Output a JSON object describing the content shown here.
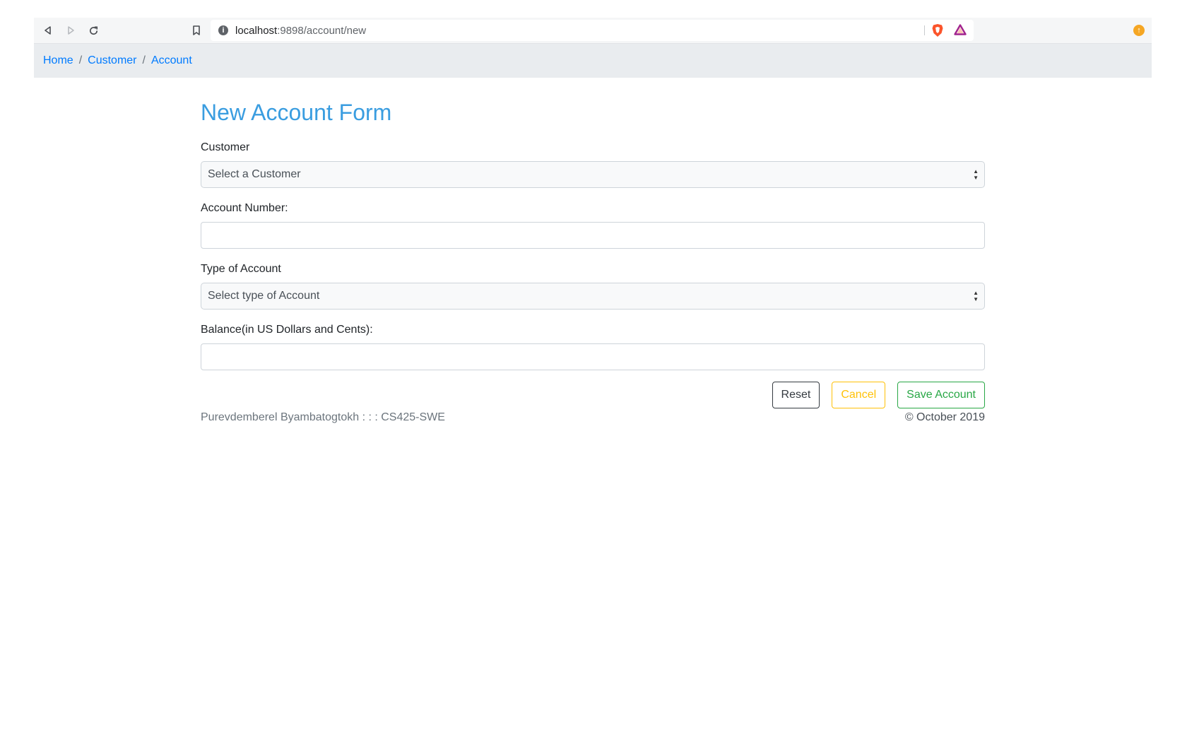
{
  "browser": {
    "url_host": "localhost",
    "url_path": ":9898/account/new",
    "info_icon": "i"
  },
  "breadcrumb": {
    "items": [
      "Home",
      "Customer",
      "Account"
    ],
    "separator": "/"
  },
  "form": {
    "title": "New Account Form",
    "customer": {
      "label": "Customer",
      "selected": "Select a Customer"
    },
    "account_number": {
      "label": "Account Number:",
      "value": ""
    },
    "account_type": {
      "label": "Type of Account",
      "selected": "Select type of Account"
    },
    "balance": {
      "label": "Balance(in US Dollars and Cents):",
      "value": ""
    },
    "buttons": {
      "reset": "Reset",
      "cancel": "Cancel",
      "save": "Save Account"
    }
  },
  "footer": {
    "author": "Purevdemberel Byambatogtokh : : : CS425-SWE",
    "copyright": "© October 2019"
  },
  "colors": {
    "title": "#3a9de0",
    "link": "#007bff",
    "reset": "#343a40",
    "cancel": "#ffc107",
    "save": "#28a745"
  }
}
